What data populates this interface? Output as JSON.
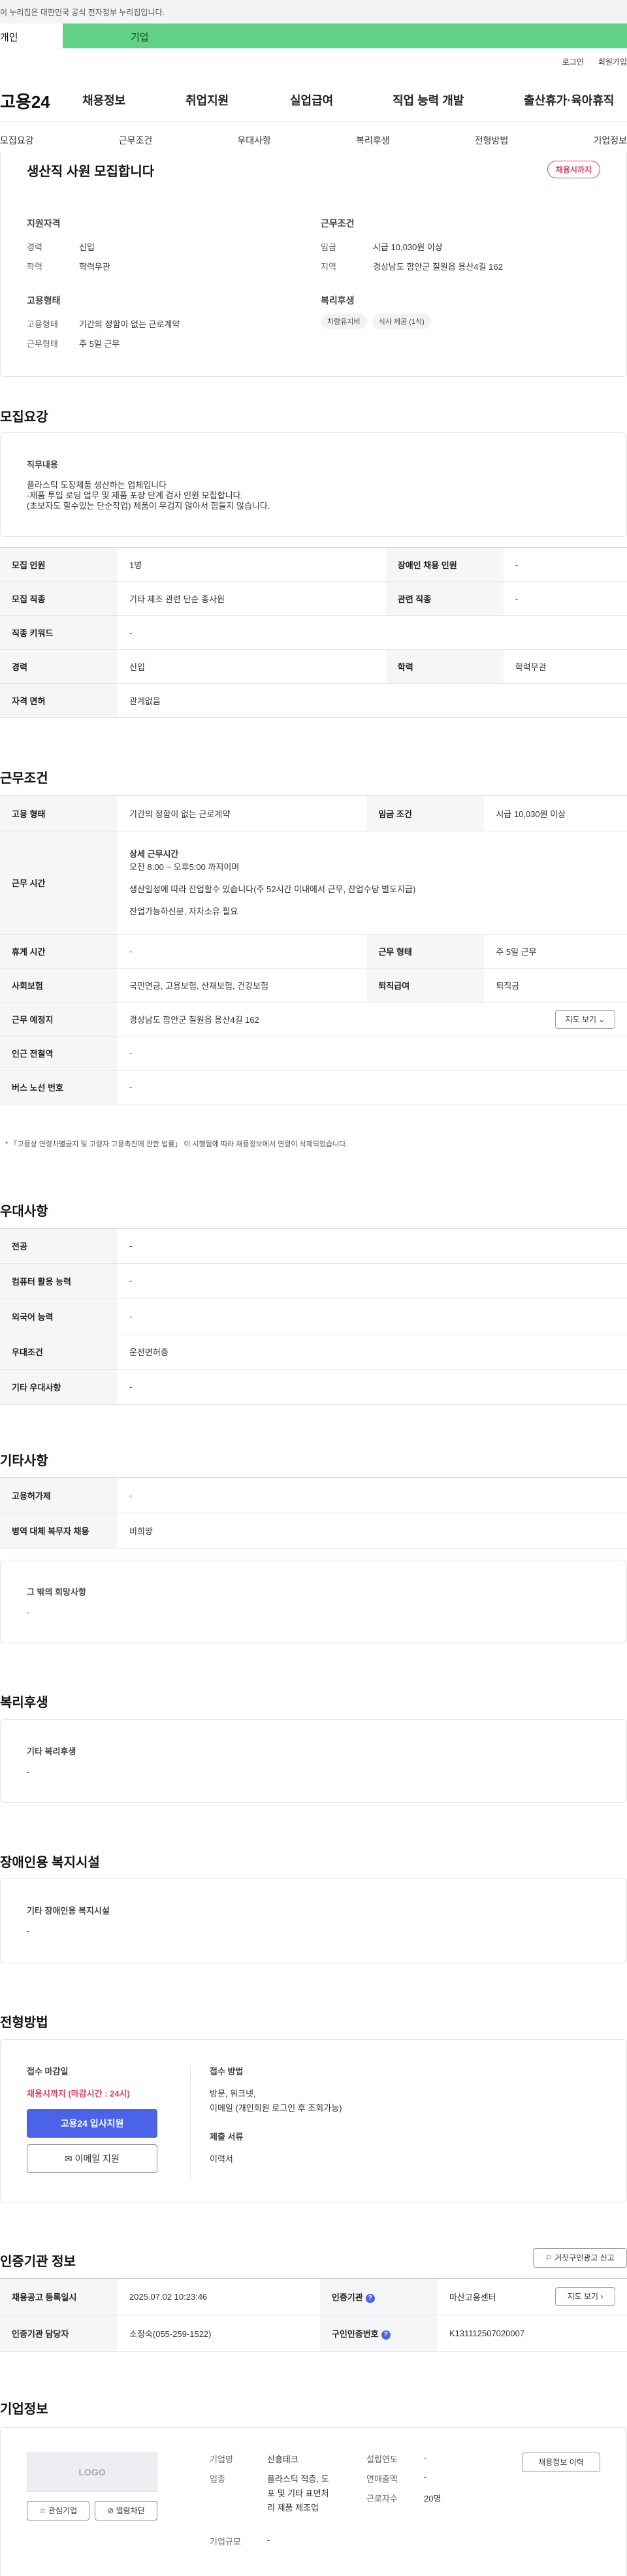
{
  "gov_banner": {
    "text": "이 누리집은 대한민국 공식 전자정부 누리집입니다."
  },
  "tabs": {
    "personal": "개인",
    "business": "기업"
  },
  "util": {
    "login": "로그인",
    "join": "회원가입"
  },
  "brand": {
    "name": "고용24"
  },
  "gnav": [
    "채용정보",
    "취업지원",
    "실업급여",
    "직업 능력 개발",
    "출산휴가·육아휴직"
  ],
  "subnav": [
    "모집요강",
    "근무조건",
    "우대사항",
    "복리후생",
    "전형방법",
    "기업정보"
  ],
  "summary": {
    "title": "생산직 사원 모집합니다",
    "badge": "채용시까지",
    "qual_title": "지원자격",
    "work_title": "근무조건",
    "emp_title": "고용형태",
    "welfare_title": "복리후생",
    "career_label": "경력",
    "career": "신입",
    "edu_label": "학력",
    "edu": "학력무관",
    "wage_label": "임금",
    "wage": "시급 10,030원 이상",
    "region_label": "지역",
    "region": "경상남도 함안군 칠원읍 용산4길 162",
    "emptype_label": "고용형태",
    "emptype": "기간의 정함이 없는 근로계약",
    "worktype_label": "근무형태",
    "worktype": "주 5일 근무",
    "chips": [
      "차량유지비",
      "식사 제공 (1식)"
    ]
  },
  "recruit": {
    "heading": "모집요강",
    "desc_title": "직무내용",
    "desc": [
      "플라스틱 도장제품 생산하는 업체입니다",
      "-제품 투입 로딩 업무 및 제품 포장 단계 검사 인원 모집합니다.",
      "(초보자도 할수있는 단순작업) 제품이 무겁지 않아서 힘들지 않습니다."
    ],
    "rows": [
      {
        "k1": "모집 인원",
        "v1": "1명",
        "k2": "장애인 채용 인원",
        "v2": "-"
      },
      {
        "k1": "모집 직종",
        "v1": "기타 제조 관련 단순 종사원",
        "k2": "관련 직종",
        "v2": "-"
      },
      {
        "k1": "직종 키워드",
        "v1": "-"
      },
      {
        "k1": "경력",
        "v1": "신입",
        "k2": "학력",
        "v2": "학력무관"
      },
      {
        "k1": "자격 면허",
        "v1": "관계없음"
      }
    ]
  },
  "conditions": {
    "heading": "근무조건",
    "emp_k": "고용 형태",
    "emp_v": "기간의 정함이 없는 근로계약",
    "wage_k": "임금 조건",
    "wage_v": "시급 10,030원 이상",
    "hours_k": "근무 시간",
    "hours_title": "상세 근무시간",
    "hours_main": "오전 8:00 ~ 오후5:00 까지이며",
    "hours_note": "생산일정에 따라 잔업할수 있습니다(주 52시간 이내에서 근무, 잔업수당 별도지급)",
    "hours_note2": "잔업가능하신분, 자차소유 필요",
    "rest_k": "휴게 시간",
    "rest_v": "-",
    "form_k": "근무 형태",
    "form_v": "주 5일 근무",
    "ins_k": "사회보험",
    "ins_v": "국민연금, 고용보험, 산재보험, 건강보험",
    "ret_k": "퇴직급여",
    "ret_v": "퇴직금",
    "place_k": "근무 예정지",
    "place_v": "경상남도 함안군 칠원읍 용산4길 162",
    "map_btn": "지도 보기",
    "subway_k": "인근 전철역",
    "subway_v": "-",
    "bus_k": "버스 노선 번호",
    "bus_v": "-",
    "notice": "* 「고용상 연령차별금지 및 고령자 고용촉진에 관한 법률」 이 시행됨에 따라 채용정보에서 연령이 삭제되었습니다."
  },
  "pref": {
    "heading": "우대사항",
    "rows": [
      [
        "전공",
        "-"
      ],
      [
        "컴퓨터 활용 능력",
        "-"
      ],
      [
        "외국어 능력",
        "-"
      ],
      [
        "우대조건",
        "운전면허증"
      ],
      [
        "기타 우대사항",
        "-"
      ]
    ]
  },
  "etc": {
    "heading": "기타사항",
    "rows": [
      [
        "고용허가제",
        "-"
      ],
      [
        "병역 대체 복무자 채용",
        "비희망"
      ]
    ],
    "other_title": "그 밖의 희망사항",
    "other_v": "-"
  },
  "welfare": {
    "heading": "복리후생",
    "title": "기타 복리후생",
    "v": "-"
  },
  "disability": {
    "heading": "장애인용 복지시설",
    "title": "기타 장애인용 복지시설",
    "v": "-"
  },
  "process": {
    "heading": "전형방법",
    "deadline_title": "접수 마감일",
    "deadline": "채용시까지 (마감시간 : 24시)",
    "apply_btn": "고용24 입사지원",
    "email_btn": "이메일 지원",
    "method_title": "접수 방법",
    "method1": "방문, 워크넷,",
    "method2": "이메일 (개인회원 로그인 후 조회가능)",
    "docs_title": "제출 서류",
    "docs": "이력서"
  },
  "agency": {
    "heading": "인증기관 정보",
    "report_btn": "거짓구인광고 신고",
    "reg_k": "채용공고 등록일시",
    "reg_v": "2025.07.02 10:23:46",
    "org_k": "인증기관",
    "org_v": "마산고용센터",
    "map_btn": "지도 보기",
    "staff_k": "인증기관 담당자",
    "staff_v": "소정숙(055-259-1522)",
    "num_k": "구인인증번호",
    "num_v": "K131112507020007"
  },
  "company": {
    "heading": "기업정보",
    "logo_text": "LOGO",
    "fav_btn": "관심기업",
    "block_btn": "열람차단",
    "name_k": "기업명",
    "name_v": "신흥테크",
    "ind_k": "업종",
    "ind_v1": "플라스틱 적층, 도",
    "ind_v2": "포 및 기타 표면처",
    "ind_v3": "리 제품 제조업",
    "scale_k": "기업규모",
    "scale_v": "-",
    "year_k": "설립연도",
    "year_v": "-",
    "sales_k": "연매출액",
    "sales_v": "-",
    "emp_k": "근로자수",
    "emp_v": "20명",
    "history_btn": "채용정보 이력"
  }
}
